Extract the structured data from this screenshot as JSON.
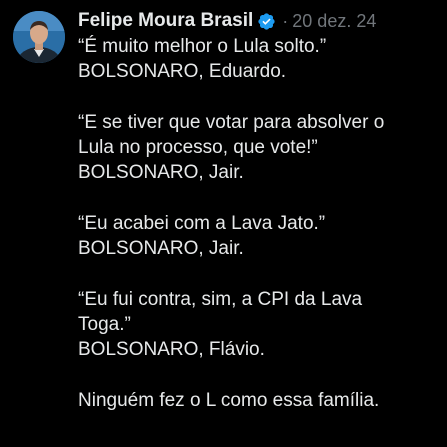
{
  "author": {
    "display_name": "Felipe Moura Brasil",
    "verified_icon": "verified-badge-icon",
    "separator": "·",
    "date": "20 dez. 24",
    "avatar_icon": "user-avatar"
  },
  "tweet": {
    "paragraphs": [
      {
        "lines": [
          "“É muito melhor o Lula solto.”",
          "BOLSONARO, Eduardo."
        ]
      },
      {
        "lines": [
          "“E se tiver que votar para absolver o",
          "Lula no processo, que vote!”",
          "BOLSONARO, Jair."
        ]
      },
      {
        "lines": [
          "“Eu acabei com a Lava Jato.”",
          "BOLSONARO, Jair."
        ]
      },
      {
        "lines": [
          "“Eu fui contra, sim, a CPI da Lava",
          "Toga.”",
          "BOLSONARO, Flávio."
        ]
      },
      {
        "lines": [
          "Ninguém fez o L como essa família."
        ]
      }
    ]
  },
  "colors": {
    "background": "#000000",
    "text": "#e7e9ea",
    "muted": "#71767b",
    "verified": "#1d9bf0"
  }
}
